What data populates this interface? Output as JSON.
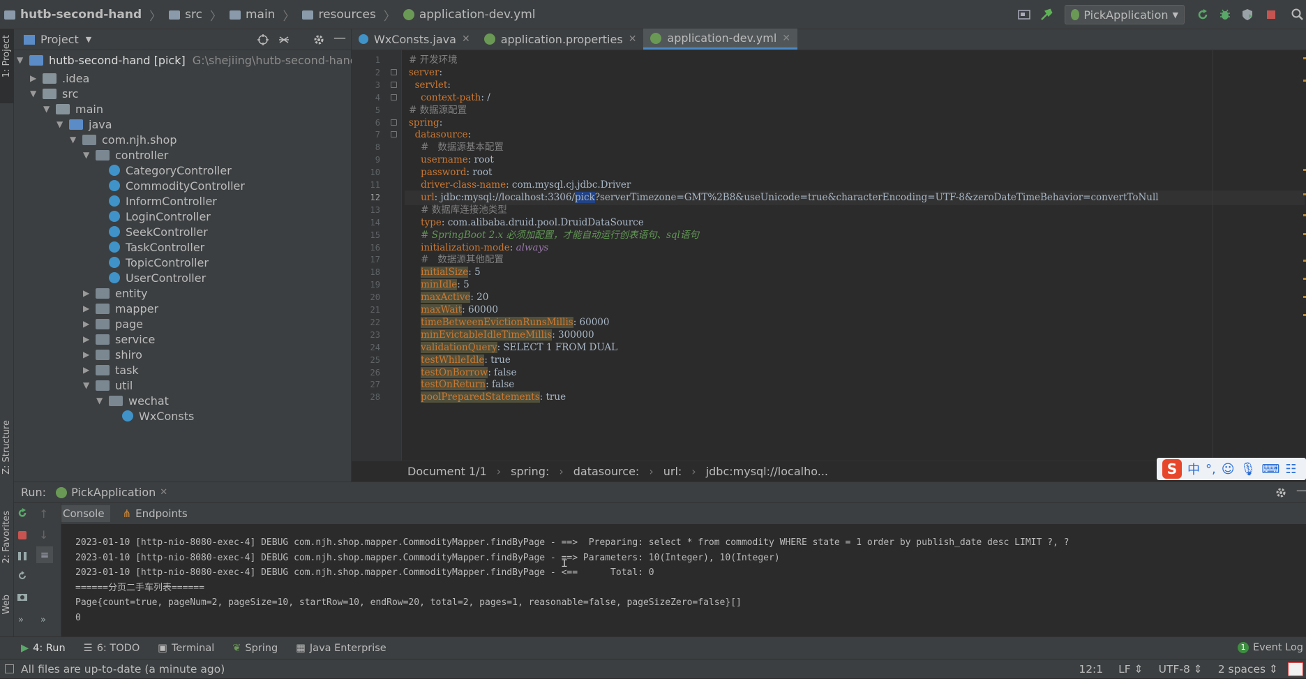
{
  "nav": {
    "breadcrumb": [
      "hutb-second-hand",
      "src",
      "main",
      "resources",
      "application-dev.yml"
    ],
    "run_config": "PickApplication"
  },
  "project_panel": {
    "title": "Project",
    "root_name": "hutb-second-hand [pick]",
    "root_path": "G:\\shejiing\\hutb-second-hand",
    "tree": [
      {
        "label": ".idea",
        "depth": 1,
        "arrow": "▶",
        "type": "folder"
      },
      {
        "label": "src",
        "depth": 1,
        "arrow": "▼",
        "type": "folder"
      },
      {
        "label": "main",
        "depth": 2,
        "arrow": "▼",
        "type": "folder"
      },
      {
        "label": "java",
        "depth": 3,
        "arrow": "▼",
        "type": "folder-blue"
      },
      {
        "label": "com.njh.shop",
        "depth": 4,
        "arrow": "▼",
        "type": "package"
      },
      {
        "label": "controller",
        "depth": 5,
        "arrow": "▼",
        "type": "package"
      },
      {
        "label": "CategoryController",
        "depth": 6,
        "arrow": "",
        "type": "class"
      },
      {
        "label": "CommodityController",
        "depth": 6,
        "arrow": "",
        "type": "class"
      },
      {
        "label": "InformController",
        "depth": 6,
        "arrow": "",
        "type": "class"
      },
      {
        "label": "LoginController",
        "depth": 6,
        "arrow": "",
        "type": "class"
      },
      {
        "label": "SeekController",
        "depth": 6,
        "arrow": "",
        "type": "class"
      },
      {
        "label": "TaskController",
        "depth": 6,
        "arrow": "",
        "type": "class"
      },
      {
        "label": "TopicController",
        "depth": 6,
        "arrow": "",
        "type": "class"
      },
      {
        "label": "UserController",
        "depth": 6,
        "arrow": "",
        "type": "class"
      },
      {
        "label": "entity",
        "depth": 5,
        "arrow": "▶",
        "type": "package"
      },
      {
        "label": "mapper",
        "depth": 5,
        "arrow": "▶",
        "type": "package"
      },
      {
        "label": "page",
        "depth": 5,
        "arrow": "▶",
        "type": "package"
      },
      {
        "label": "service",
        "depth": 5,
        "arrow": "▶",
        "type": "package"
      },
      {
        "label": "shiro",
        "depth": 5,
        "arrow": "▶",
        "type": "package"
      },
      {
        "label": "task",
        "depth": 5,
        "arrow": "▶",
        "type": "package"
      },
      {
        "label": "util",
        "depth": 5,
        "arrow": "▼",
        "type": "package"
      },
      {
        "label": "wechat",
        "depth": 6,
        "arrow": "▼",
        "type": "package"
      },
      {
        "label": "WxConsts",
        "depth": 7,
        "arrow": "",
        "type": "class"
      }
    ]
  },
  "side_strip": {
    "project": "1: Project",
    "structure": "Z: Structure",
    "favorites": "2: Favorites",
    "web": "Web"
  },
  "editor": {
    "tabs": [
      "WxConsts.java",
      "application.properties",
      "application-dev.yml"
    ],
    "active_tab": 2,
    "lines": [
      {
        "n": "1",
        "segs": [
          [
            "c",
            "# 开发环境"
          ]
        ]
      },
      {
        "n": "2",
        "segs": [
          [
            "k",
            "server"
          ],
          [
            "v",
            ":"
          ]
        ]
      },
      {
        "n": "3",
        "segs": [
          [
            "v",
            "  "
          ],
          [
            "k",
            "servlet"
          ],
          [
            "v",
            ":"
          ]
        ]
      },
      {
        "n": "4",
        "segs": [
          [
            "v",
            "    "
          ],
          [
            "k",
            "context-path"
          ],
          [
            "v",
            ": /"
          ]
        ]
      },
      {
        "n": "5",
        "segs": [
          [
            "c",
            "# 数据源配置"
          ]
        ]
      },
      {
        "n": "6",
        "segs": [
          [
            "k",
            "spring"
          ],
          [
            "v",
            ":"
          ]
        ]
      },
      {
        "n": "7",
        "segs": [
          [
            "v",
            "  "
          ],
          [
            "k",
            "datasource"
          ],
          [
            "v",
            ":"
          ]
        ]
      },
      {
        "n": "8",
        "segs": [
          [
            "v",
            "    "
          ],
          [
            "c",
            "#   数据源基本配置"
          ]
        ]
      },
      {
        "n": "9",
        "segs": [
          [
            "v",
            "    "
          ],
          [
            "k",
            "username"
          ],
          [
            "v",
            ": root"
          ]
        ]
      },
      {
        "n": "10",
        "segs": [
          [
            "v",
            "    "
          ],
          [
            "k",
            "password"
          ],
          [
            "v",
            ": root"
          ]
        ]
      },
      {
        "n": "11",
        "segs": [
          [
            "v",
            "    "
          ],
          [
            "k",
            "driver-class-name"
          ],
          [
            "v",
            ": com.mysql.cj.jdbc.Driver"
          ]
        ]
      },
      {
        "n": "12",
        "segs": [
          [
            "v",
            "    "
          ],
          [
            "k",
            "url"
          ],
          [
            "v",
            ": jdbc:mysql://localhost:3306/"
          ],
          [
            "sel",
            "pick"
          ],
          [
            "v",
            "?serverTimezone=GMT%2B8&useUnicode=true&characterEncoding=UTF-8&zeroDateTimeBehavior=convertToNull"
          ]
        ]
      },
      {
        "n": "13",
        "segs": [
          [
            "v",
            "    "
          ],
          [
            "c",
            "# 数据库连接池类型"
          ]
        ]
      },
      {
        "n": "14",
        "segs": [
          [
            "v",
            "    "
          ],
          [
            "k",
            "type"
          ],
          [
            "v",
            ": com.alibaba.druid.pool.DruidDataSource"
          ]
        ]
      },
      {
        "n": "15",
        "segs": [
          [
            "v",
            "    "
          ],
          [
            "ci",
            "# SpringBoot 2.x 必须加配置，才能自动运行创表语句、sql语句"
          ]
        ]
      },
      {
        "n": "16",
        "segs": [
          [
            "v",
            "    "
          ],
          [
            "k",
            "initialization-mode"
          ],
          [
            "v",
            ": "
          ],
          [
            "it",
            "always"
          ]
        ]
      },
      {
        "n": "17",
        "segs": [
          [
            "v",
            "    "
          ],
          [
            "c",
            "#   数据源其他配置"
          ]
        ]
      },
      {
        "n": "18",
        "segs": [
          [
            "v",
            "    "
          ],
          [
            "kh",
            "initialSize"
          ],
          [
            "v",
            ": 5"
          ]
        ]
      },
      {
        "n": "19",
        "segs": [
          [
            "v",
            "    "
          ],
          [
            "kh",
            "minIdle"
          ],
          [
            "v",
            ": 5"
          ]
        ]
      },
      {
        "n": "20",
        "segs": [
          [
            "v",
            "    "
          ],
          [
            "kh",
            "maxActive"
          ],
          [
            "v",
            ": 20"
          ]
        ]
      },
      {
        "n": "21",
        "segs": [
          [
            "v",
            "    "
          ],
          [
            "kh",
            "maxWait"
          ],
          [
            "v",
            ": 60000"
          ]
        ]
      },
      {
        "n": "22",
        "segs": [
          [
            "v",
            "    "
          ],
          [
            "kh",
            "timeBetweenEvictionRunsMillis"
          ],
          [
            "v",
            ": 60000"
          ]
        ]
      },
      {
        "n": "23",
        "segs": [
          [
            "v",
            "    "
          ],
          [
            "kh",
            "minEvictableIdleTimeMillis"
          ],
          [
            "v",
            ": 300000"
          ]
        ]
      },
      {
        "n": "24",
        "segs": [
          [
            "v",
            "    "
          ],
          [
            "kh",
            "validationQuery"
          ],
          [
            "v",
            ": SELECT 1 FROM DUAL"
          ]
        ]
      },
      {
        "n": "25",
        "segs": [
          [
            "v",
            "    "
          ],
          [
            "kh",
            "testWhileIdle"
          ],
          [
            "v",
            ": true"
          ]
        ]
      },
      {
        "n": "26",
        "segs": [
          [
            "v",
            "    "
          ],
          [
            "kh",
            "testOnBorrow"
          ],
          [
            "v",
            ": false"
          ]
        ]
      },
      {
        "n": "27",
        "segs": [
          [
            "v",
            "    "
          ],
          [
            "kh",
            "testOnReturn"
          ],
          [
            "v",
            ": false"
          ]
        ]
      },
      {
        "n": "28",
        "segs": [
          [
            "v",
            "    "
          ],
          [
            "kh",
            "poolPreparedStatements"
          ],
          [
            "v",
            ": true"
          ]
        ]
      }
    ],
    "current_line": "12",
    "breadcrumb": [
      "Document 1/1",
      "spring:",
      "datasource:",
      "url:",
      "jdbc:mysql://localho..."
    ]
  },
  "run_panel": {
    "label": "Run:",
    "config": "PickApplication",
    "console_tab": "Console",
    "endpoints_tab": "Endpoints",
    "output": [
      "2023-01-10 [http-nio-8080-exec-4] DEBUG com.njh.shop.mapper.CommodityMapper.findByPage - ==>  Preparing: select * from commodity WHERE state = 1 order by publish_date desc LIMIT ?, ?",
      "2023-01-10 [http-nio-8080-exec-4] DEBUG com.njh.shop.mapper.CommodityMapper.findByPage - ==> Parameters: 10(Integer), 10(Integer)",
      "2023-01-10 [http-nio-8080-exec-4] DEBUG com.njh.shop.mapper.CommodityMapper.findByPage - <==      Total: 0",
      "======分页二手车列表======",
      "Page{count=true, pageNum=2, pageSize=10, startRow=10, endRow=20, total=2, pages=1, reasonable=false, pageSizeZero=false}[]",
      "0"
    ]
  },
  "bottom_tabs": [
    "4: Run",
    "6: TODO",
    "Terminal",
    "Spring",
    "Java Enterprise"
  ],
  "event_log": "Event Log",
  "event_count": "1",
  "status": {
    "message": "All files are up-to-date (a minute ago)",
    "position": "12:1",
    "line_sep": "LF",
    "encoding": "UTF-8",
    "indent": "2 spaces"
  },
  "ime": {
    "logo": "S",
    "chinese": "中"
  },
  "colors": {
    "accent": "#4a88c7",
    "keyword": "#cc7832",
    "comment": "#808080"
  }
}
